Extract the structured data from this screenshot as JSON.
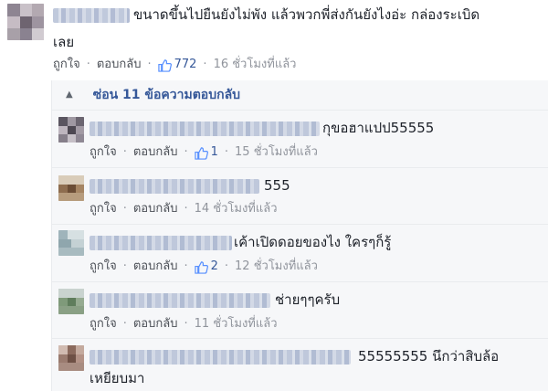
{
  "main_comment": {
    "text": "ขนาดขึ้นไปยืนยังไม่พัง แล้วพวกพี่ส่งกันยังไงอ่ะ กล่องระเบิด",
    "text_line2": "เลย",
    "like_label": "ถูกใจ",
    "reply_label": "ตอบกลับ",
    "likes": "772",
    "time": "16 ชั่วโมงที่แล้ว"
  },
  "hide_replies": {
    "icon": "caret-up-icon",
    "label": "ซ่อน 11 ข้อความตอบกลับ"
  },
  "replies": [
    {
      "text": "กุขอฮาแปป55555",
      "like_label": "ถูกใจ",
      "reply_label": "ตอบกลับ",
      "likes": "1",
      "time": "15 ชั่วโมงที่แล้ว"
    },
    {
      "text": "555",
      "like_label": "ถูกใจ",
      "reply_label": "ตอบกลับ",
      "likes": "",
      "time": "14 ชั่วโมงที่แล้ว"
    },
    {
      "text": "เค้าเปิดดอยของไง ใครๆก็รู้",
      "like_label": "ถูกใจ",
      "reply_label": "ตอบกลับ",
      "likes": "2",
      "time": "12 ชั่วโมงที่แล้ว"
    },
    {
      "text": "ช่ายๆๆครับ",
      "like_label": "ถูกใจ",
      "reply_label": "ตอบกลับ",
      "likes": "",
      "time": "11 ชั่วโมงที่แล้ว"
    },
    {
      "text": "55555555 นึกว่าสิบล้อ",
      "text_line2": "เหยียบมา"
    }
  ],
  "colors": {
    "link": "#365899",
    "meta": "#90949c",
    "text": "#1d2129",
    "reply_bg": "#f6f7f9"
  }
}
